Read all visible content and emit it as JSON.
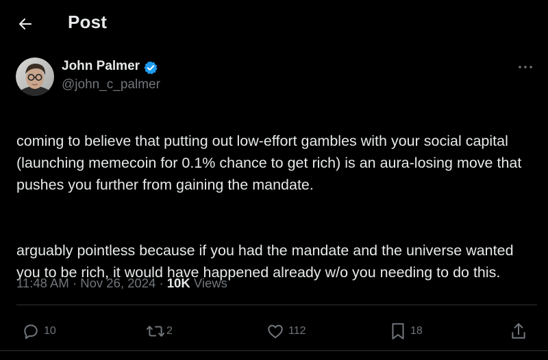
{
  "header": {
    "title": "Post"
  },
  "author": {
    "name": "John Palmer",
    "handle": "@john_c_palmer",
    "verified_color": "#1d9bf0"
  },
  "post": {
    "paragraphs": [
      "coming to believe that putting out low-effort gambles with your social capital (launching memecoin for 0.1% chance to get rich) is an aura-losing move that pushes you further from gaining the mandate.",
      "arguably pointless because if you had the mandate and the universe wanted you to be rich, it would have happened already w/o you needing to do this."
    ],
    "time": "11:48 AM",
    "separator": "·",
    "date": "Nov 26, 2024",
    "views_count": "10K",
    "views_label": "Views"
  },
  "actions": {
    "replies": "10",
    "reposts": "2",
    "likes": "112",
    "bookmarks": "18"
  },
  "icons": {
    "back": "arrow-left-icon",
    "verified": "verified-badge-icon",
    "more": "more-horizontal-icon",
    "reply": "reply-icon",
    "repost": "repost-icon",
    "like": "heart-icon",
    "bookmark": "bookmark-icon",
    "share": "share-icon"
  },
  "colors": {
    "background": "#000000",
    "text": "#e7e9ea",
    "muted": "#71767b",
    "accent": "#1d9bf0",
    "divider": "#2f3336"
  }
}
